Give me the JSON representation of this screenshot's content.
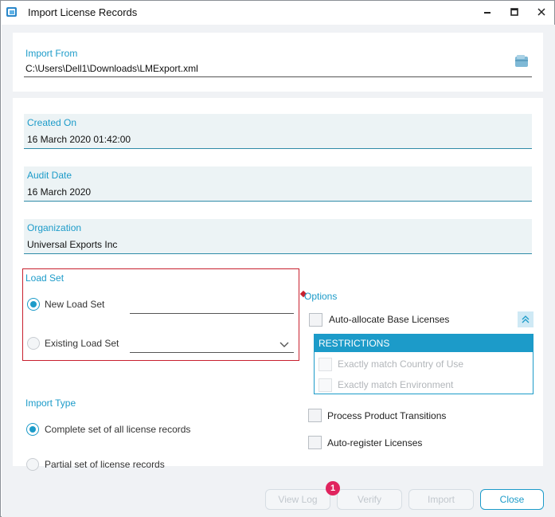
{
  "window": {
    "title": "Import License Records",
    "app_icon": "import-records-icon",
    "controls": [
      "minimize-icon",
      "maximize-icon",
      "close-icon"
    ]
  },
  "import_from": {
    "label": "Import From",
    "value": "C:\\Users\\Dell1\\Downloads\\LMExport.xml",
    "browse_icon": "folder-icon"
  },
  "created_on": {
    "label": "Created On",
    "value": "16 March 2020 01:42:00"
  },
  "audit_date": {
    "label": "Audit Date",
    "value": "16 March 2020"
  },
  "organization": {
    "label": "Organization",
    "value": "Universal Exports Inc"
  },
  "load_set": {
    "title": "Load Set",
    "new_label": "New Load Set",
    "new_selected": true,
    "new_value": "",
    "existing_label": "Existing Load Set",
    "existing_value": ""
  },
  "import_type": {
    "title": "Import Type",
    "complete_label": "Complete set of all license records",
    "partial_label": "Partial set of license records",
    "selected": "complete"
  },
  "options": {
    "title": "Options",
    "auto_allocate": "Auto-allocate Base Licenses",
    "restrictions_title": "RESTRICTIONS",
    "match_country": "Exactly match Country of Use",
    "match_environment": "Exactly match Environment",
    "process_transitions": "Process Product Transitions",
    "auto_register": "Auto-register Licenses"
  },
  "footer": {
    "view_log": "View Log",
    "verify": "Verify",
    "verify_badge": "1",
    "import": "Import",
    "close": "Close"
  },
  "colors": {
    "accent": "#1c9bc9",
    "error": "#c8202e",
    "badge": "#e0245e"
  }
}
